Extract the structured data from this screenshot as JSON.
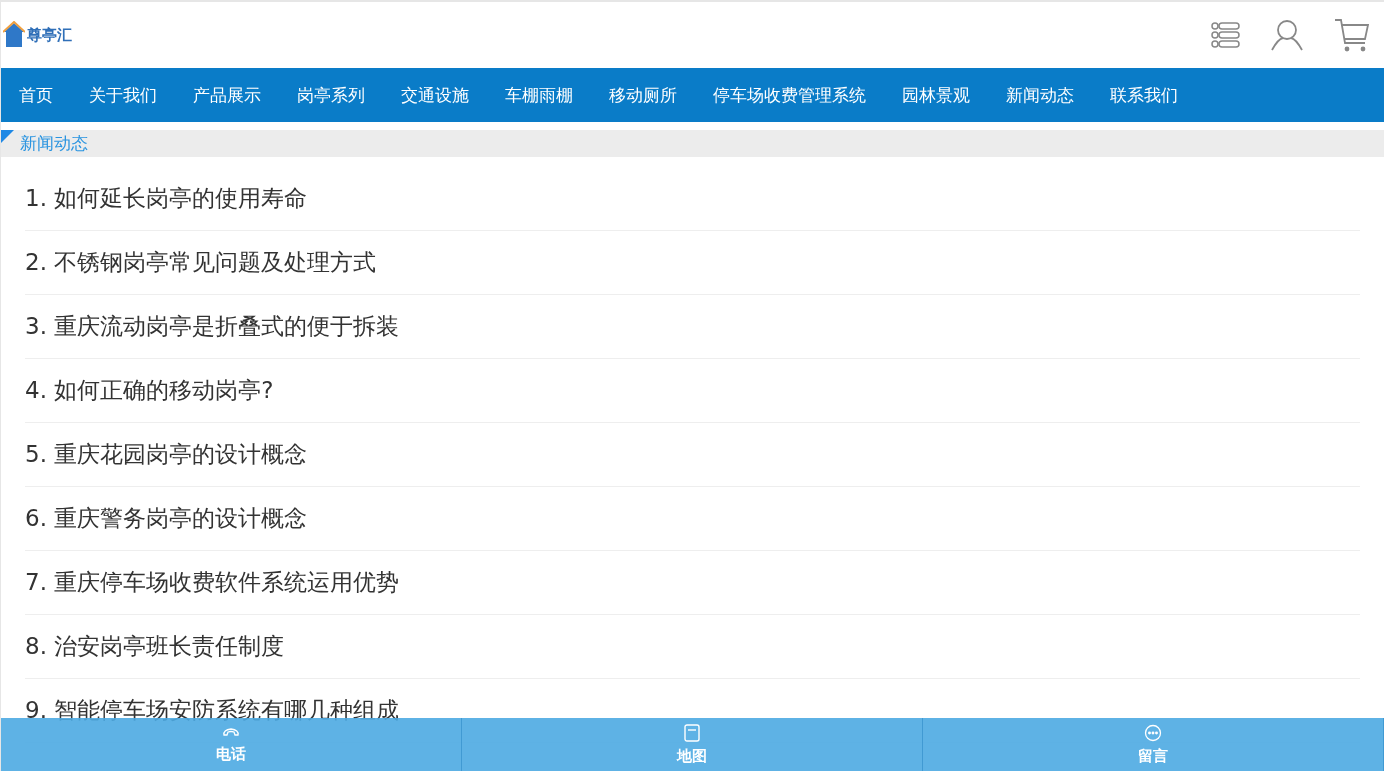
{
  "logo": {
    "text": "尊亭汇"
  },
  "nav": [
    {
      "label": "首页"
    },
    {
      "label": "关于我们"
    },
    {
      "label": "产品展示"
    },
    {
      "label": "岗亭系列"
    },
    {
      "label": "交通设施"
    },
    {
      "label": "车棚雨棚"
    },
    {
      "label": "移动厕所"
    },
    {
      "label": "停车场收费管理系统"
    },
    {
      "label": "园林景观"
    },
    {
      "label": "新闻动态"
    },
    {
      "label": "联系我们"
    }
  ],
  "section": {
    "title": "新闻动态"
  },
  "articles": [
    {
      "title": "1. 如何延长岗亭的使用寿命"
    },
    {
      "title": "2. 不锈钢岗亭常见问题及处理方式"
    },
    {
      "title": "3. 重庆流动岗亭是折叠式的便于拆装"
    },
    {
      "title": "4. 如何正确的移动岗亭?"
    },
    {
      "title": "5. 重庆花园岗亭的设计概念"
    },
    {
      "title": "6. 重庆警务岗亭的设计概念"
    },
    {
      "title": "7. 重庆停车场收费软件系统运用优势"
    },
    {
      "title": "8. 治安岗亭班长责任制度"
    },
    {
      "title": "9. 智能停车场安防系统有哪几种组成"
    }
  ],
  "bottom_bar": [
    {
      "kind": "phone",
      "label": "电话"
    },
    {
      "kind": "map",
      "label": "地图"
    },
    {
      "kind": "message",
      "label": "留言"
    }
  ]
}
